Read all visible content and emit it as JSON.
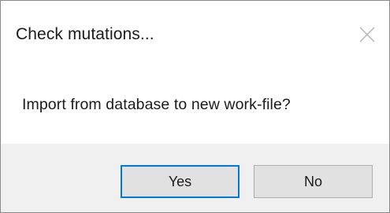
{
  "dialog": {
    "title": "Check mutations...",
    "message": "Import from database to new work-file?",
    "close_icon": "close-icon",
    "buttons": {
      "yes_label": "Yes",
      "no_label": "No"
    }
  },
  "colors": {
    "footer_bg": "#f0f0f0",
    "button_bg": "#e1e1e1",
    "default_button_border": "#0078d7",
    "text": "#1b1b1b"
  }
}
